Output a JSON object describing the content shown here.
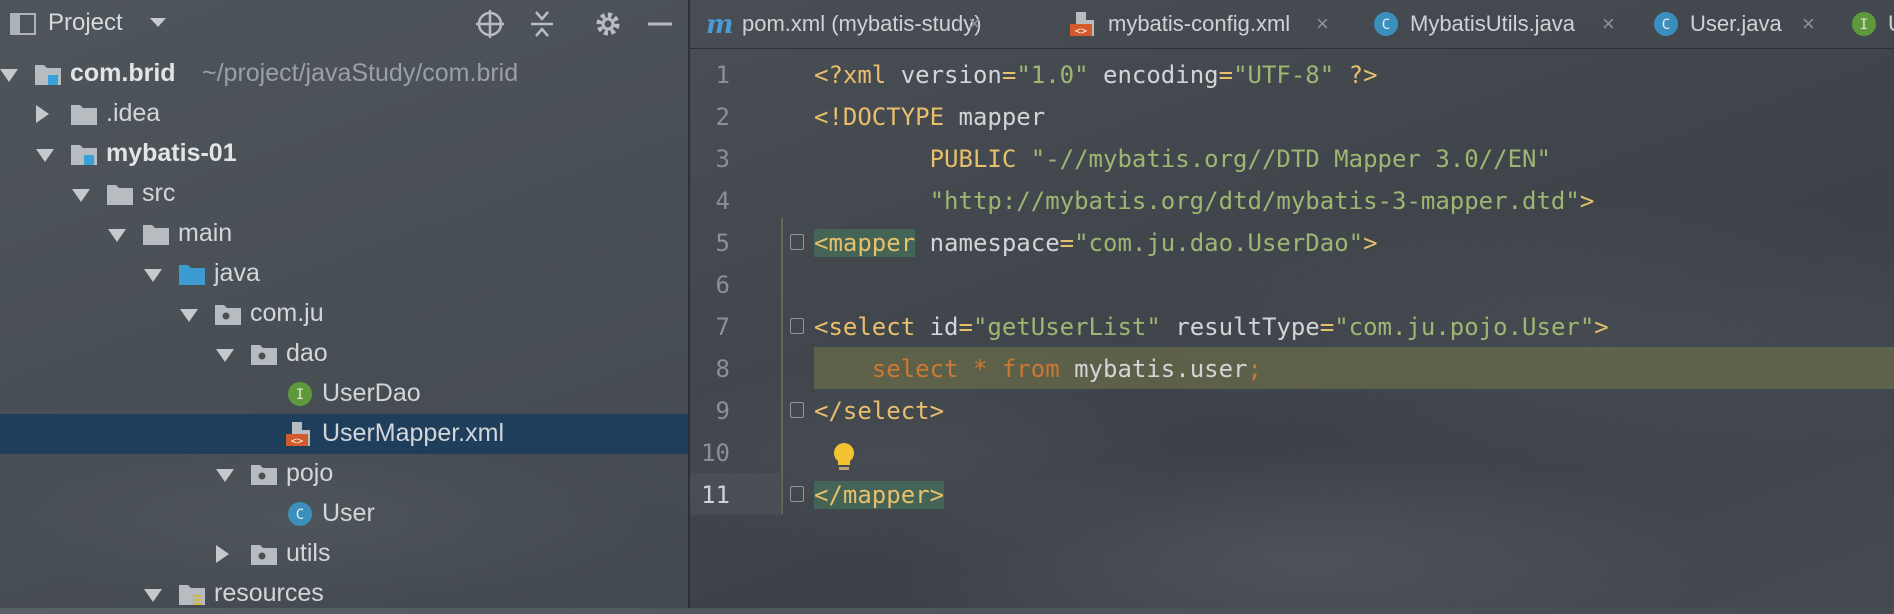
{
  "project_panel": {
    "title": "Project",
    "tree": [
      {
        "label": "com.brid",
        "path": "~/project/javaStudy/com.brid",
        "bold": true,
        "expanded": true,
        "icon": "module-folder-icon"
      },
      {
        "label": ".idea",
        "expanded": false,
        "icon": "folder-icon"
      },
      {
        "label": "mybatis-01",
        "bold": true,
        "expanded": true,
        "icon": "module-folder-icon"
      },
      {
        "label": "src",
        "expanded": true,
        "icon": "folder-icon"
      },
      {
        "label": "main",
        "expanded": true,
        "icon": "folder-icon"
      },
      {
        "label": "java",
        "expanded": true,
        "icon": "source-folder-icon"
      },
      {
        "label": "com.ju",
        "expanded": true,
        "icon": "package-icon"
      },
      {
        "label": "dao",
        "expanded": true,
        "icon": "package-icon"
      },
      {
        "label": "UserDao",
        "icon": "interface-icon"
      },
      {
        "label": "UserMapper.xml",
        "icon": "xml-file-icon",
        "selected": true
      },
      {
        "label": "pojo",
        "expanded": true,
        "icon": "package-icon"
      },
      {
        "label": "User",
        "icon": "class-icon"
      },
      {
        "label": "utils",
        "expanded": false,
        "icon": "package-icon"
      },
      {
        "label": "resources",
        "expanded": true,
        "icon": "resources-folder-icon"
      }
    ]
  },
  "tabs": [
    {
      "label": "pom.xml (mybatis-study)",
      "icon": "maven-icon",
      "close": "×"
    },
    {
      "label": "mybatis-config.xml",
      "icon": "xml-file-icon",
      "close": "×"
    },
    {
      "label": "MybatisUtils.java",
      "icon": "class-icon",
      "close": "×"
    },
    {
      "label": "User.java",
      "icon": "class-icon",
      "close": "×"
    },
    {
      "label": "U",
      "icon": "interface-icon",
      "close": ""
    }
  ],
  "editor": {
    "lines": [
      {
        "num": "1",
        "tokens": [
          [
            "t-tag",
            "<?xml "
          ],
          [
            "t-attr",
            "version"
          ],
          [
            "t-tag",
            "="
          ],
          [
            "t-val",
            "\"1.0\""
          ],
          [
            "t-attr",
            " encoding"
          ],
          [
            "t-tag",
            "="
          ],
          [
            "t-val",
            "\"UTF-8\""
          ],
          [
            "t-tag",
            " ?>"
          ]
        ]
      },
      {
        "num": "2",
        "tokens": [
          [
            "t-tag",
            "<!DOCTYPE "
          ],
          [
            "t-id",
            "mapper"
          ]
        ]
      },
      {
        "num": "3",
        "tokens": [
          [
            "t-tag",
            "        PUBLIC "
          ],
          [
            "t-val",
            "\"-//mybatis.org//DTD Mapper 3.0//EN\""
          ]
        ]
      },
      {
        "num": "4",
        "tokens": [
          [
            "t-val",
            "        \"http://mybatis.org/dtd/mybatis-3-mapper.dtd\""
          ],
          [
            "t-tag",
            ">"
          ]
        ]
      },
      {
        "num": "5",
        "fold": true,
        "tokens": [
          [
            "t-tag tag-hl",
            "<mapper"
          ],
          [
            "t-attr",
            " namespace"
          ],
          [
            "t-tag",
            "="
          ],
          [
            "t-val",
            "\"com.ju.dao.UserDao\""
          ],
          [
            "t-tag",
            ">"
          ]
        ]
      },
      {
        "num": "6",
        "tokens": []
      },
      {
        "num": "7",
        "fold": true,
        "tokens": [
          [
            "t-tag",
            "<select "
          ],
          [
            "t-attr",
            "id"
          ],
          [
            "t-tag",
            "="
          ],
          [
            "t-val",
            "\"getUserList\""
          ],
          [
            "t-attr",
            " resultType"
          ],
          [
            "t-tag",
            "="
          ],
          [
            "t-val",
            "\"com.ju.pojo.User\""
          ],
          [
            "t-tag",
            ">"
          ]
        ]
      },
      {
        "num": "8",
        "highlight": true,
        "tokens": [
          [
            "t-kw",
            "    select "
          ],
          [
            "t-kw",
            "* "
          ],
          [
            "t-kw",
            "from "
          ],
          [
            "t-id",
            "mybatis.user"
          ],
          [
            "t-kw",
            ";"
          ]
        ]
      },
      {
        "num": "9",
        "fold": true,
        "tokens": [
          [
            "t-tag",
            "</select>"
          ]
        ]
      },
      {
        "num": "10",
        "tokens": []
      },
      {
        "num": "11",
        "fold": true,
        "current": true,
        "tokens": [
          [
            "t-tag tag-hl",
            "</mapper>"
          ]
        ]
      }
    ]
  }
}
